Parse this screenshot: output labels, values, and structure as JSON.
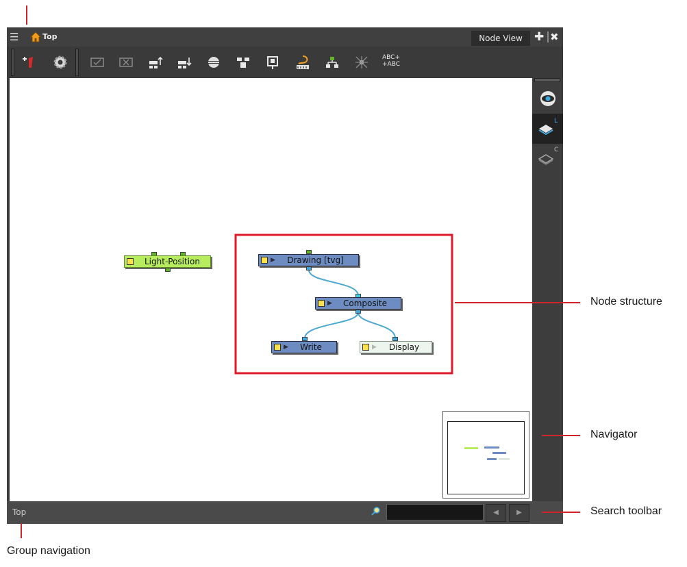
{
  "window": {
    "group_label": "Top",
    "tab_label": "Node View",
    "menu_icon": "hamburger-menu-icon",
    "home_icon": "home-icon",
    "add_icon": "plus-icon",
    "close_icon": "close-icon"
  },
  "toolbar": {
    "icons": [
      "add-node-icon",
      "settings-gear-icon",
      "enable-icon",
      "disable-icon",
      "move-up-icon",
      "move-down-icon",
      "cable-icon",
      "group-icon",
      "ungroup-icon",
      "layer-icon",
      "hierarchy-icon",
      "network-icon",
      "rename-abc-icon"
    ],
    "rename_label": "ABC+ +ABC"
  },
  "nodes": {
    "light_position": "Light-Position",
    "drawing": "Drawing  [tvg]",
    "composite": "Composite",
    "write": "Write",
    "display": "Display"
  },
  "side_panel": {
    "eye_icon": "eye-icon",
    "layer_L_icon": "layer-icon",
    "layer_L_badge": "L",
    "layer_C_icon": "layer-outline-icon",
    "layer_C_badge": "C"
  },
  "status_bar": {
    "group_path": "Top",
    "search_placeholder": "",
    "search_value": "",
    "prev_icon": "arrow-left-icon",
    "next_icon": "arrow-right-icon"
  },
  "annotations": {
    "node_structure": "Node structure",
    "navigator": "Navigator",
    "search_toolbar": "Search toolbar",
    "group_navigation": "Group navigation"
  },
  "colors": {
    "node_blue": "#6c8cc2",
    "node_green": "#b6ec5e",
    "node_display": "#eef5ee",
    "wire": "#4aa8d0",
    "highlight_red": "#e0182a"
  }
}
